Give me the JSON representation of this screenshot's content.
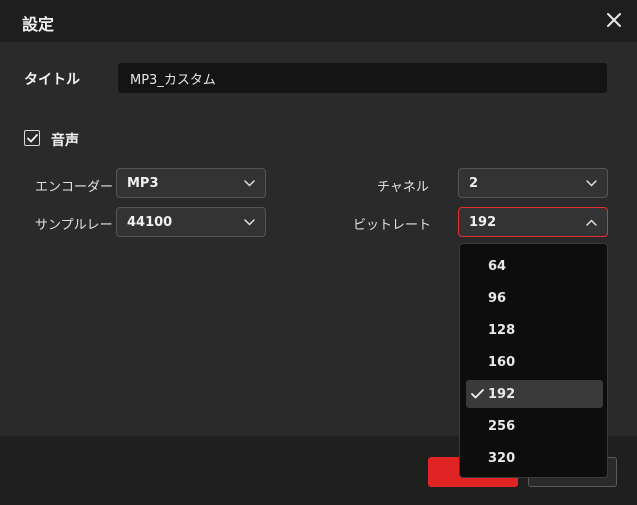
{
  "dialog": {
    "title": "設定",
    "close_icon": "close-icon"
  },
  "form": {
    "title_label": "タイトル",
    "title_value": "MP3_カスタム",
    "audio_label": "音声",
    "audio_checked": true,
    "encoder_label": "エンコーダー",
    "encoder_value": "MP3",
    "channel_label": "チャネル",
    "channel_value": "2",
    "samplerate_label": "サンプルレート",
    "samplerate_value": "44100",
    "bitrate_label": "ビットレート",
    "bitrate_value": "192"
  },
  "bitrate_dropdown": {
    "options": [
      "64",
      "96",
      "128",
      "160",
      "192",
      "256",
      "320"
    ],
    "selected": "192"
  },
  "colors": {
    "accent": "#e02424",
    "active_border": "#e03030",
    "background": "#2a2a2a",
    "header": "#1e1e1e"
  }
}
